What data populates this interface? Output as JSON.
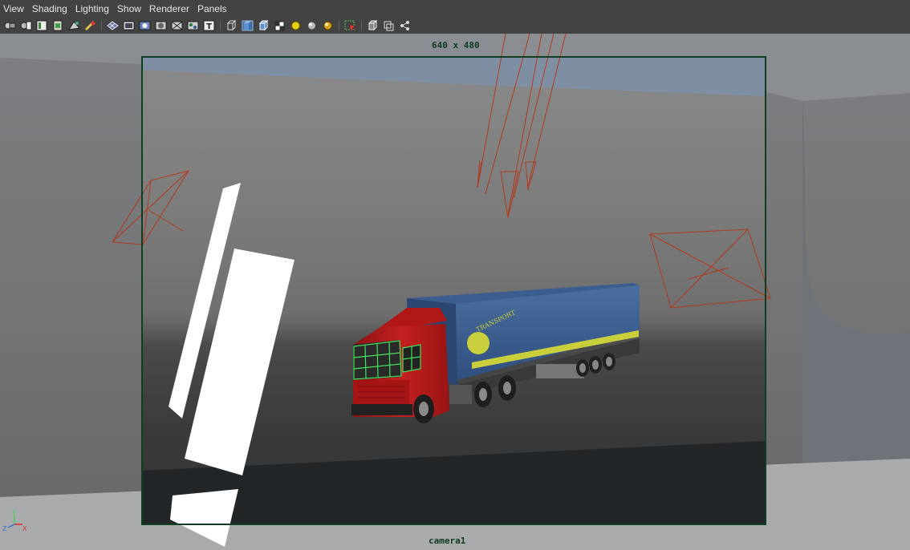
{
  "menubar": {
    "items": [
      "View",
      "Shading",
      "Lighting",
      "Show",
      "Renderer",
      "Panels"
    ]
  },
  "toolbar": {
    "icons": [
      "select-camera-icon",
      "camera-attributes-icon",
      "bookmarks-icon",
      "image-plane-icon",
      "two-d-pan-zoom-icon",
      "grease-pencil-icon",
      "grid-icon",
      "film-gate-icon",
      "resolution-gate-icon",
      "gate-mask-icon",
      "field-chart-icon",
      "safe-action-icon",
      "safe-title-icon",
      "wireframe-icon",
      "smooth-shade-icon",
      "wireframe-on-shaded-icon",
      "textured-icon",
      "use-all-lights-icon",
      "shadows-icon",
      "screen-space-ao-icon",
      "isolate-select-icon",
      "xray-icon",
      "xray-active-components-icon",
      "xray-joints-icon"
    ]
  },
  "viewport": {
    "resolution_label": "640 x 480",
    "camera_name": "camera1",
    "gate_color": "#0f3f22",
    "light_color": "#b33a1e",
    "axis_labels": {
      "x": "X",
      "y": "Y",
      "z": "Z"
    }
  },
  "scene": {
    "trailer_text": "TRANSPORT"
  }
}
